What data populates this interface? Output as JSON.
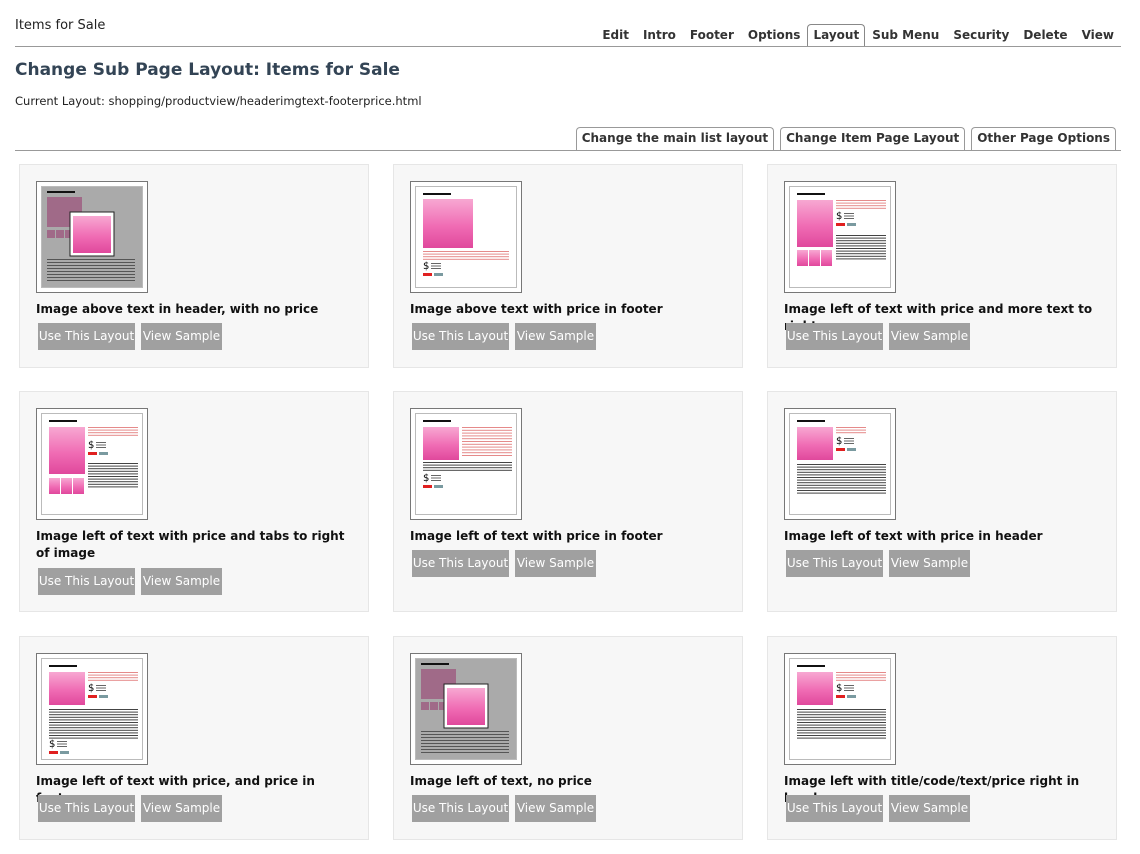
{
  "site": {
    "title": "Items for Sale"
  },
  "top_tabs": [
    {
      "label": "Edit",
      "active": false
    },
    {
      "label": "Intro",
      "active": false
    },
    {
      "label": "Footer",
      "active": false
    },
    {
      "label": "Options",
      "active": false
    },
    {
      "label": "Layout",
      "active": true
    },
    {
      "label": "Sub Menu",
      "active": false
    },
    {
      "label": "Security",
      "active": false
    },
    {
      "label": "Delete",
      "active": false
    },
    {
      "label": "View",
      "active": false
    }
  ],
  "page": {
    "title": "Change Sub Page Layout: Items for Sale",
    "current_layout": "Current Layout: shopping/productview/headerimgtext-footerprice.html"
  },
  "sub_tabs": [
    {
      "label": "Change the main list layout"
    },
    {
      "label": "Change Item Page Layout"
    },
    {
      "label": "Other Page Options"
    }
  ],
  "buttons": {
    "use": "Use This Layout",
    "view": "View Sample"
  },
  "layouts": [
    {
      "label": "Image above text in header, with no price",
      "thumb": "overlay"
    },
    {
      "label": "Image above text with price in footer",
      "thumb": "above-footer"
    },
    {
      "label": "Image left of text with price and more text to right",
      "thumb": "left-more"
    },
    {
      "label": "Image left of text with price and tabs to right of image",
      "thumb": "left-tabs"
    },
    {
      "label": "Image left of text with price in footer",
      "thumb": "left-footer"
    },
    {
      "label": "Image left of text with price in header",
      "thumb": "left-header"
    },
    {
      "label": "Image left of text with price, and price in footer",
      "thumb": "left-both"
    },
    {
      "label": "Image left of text, no price",
      "thumb": "overlay"
    },
    {
      "label": "Image left with title/code/text/price right in header",
      "thumb": "left-right-header"
    }
  ],
  "colors": {
    "pink": "#f06cb4",
    "pink_dark": "#e0489c",
    "price_red": "#e02020",
    "btn_gray": "#a0a0a0",
    "title_blue": "#334455"
  }
}
